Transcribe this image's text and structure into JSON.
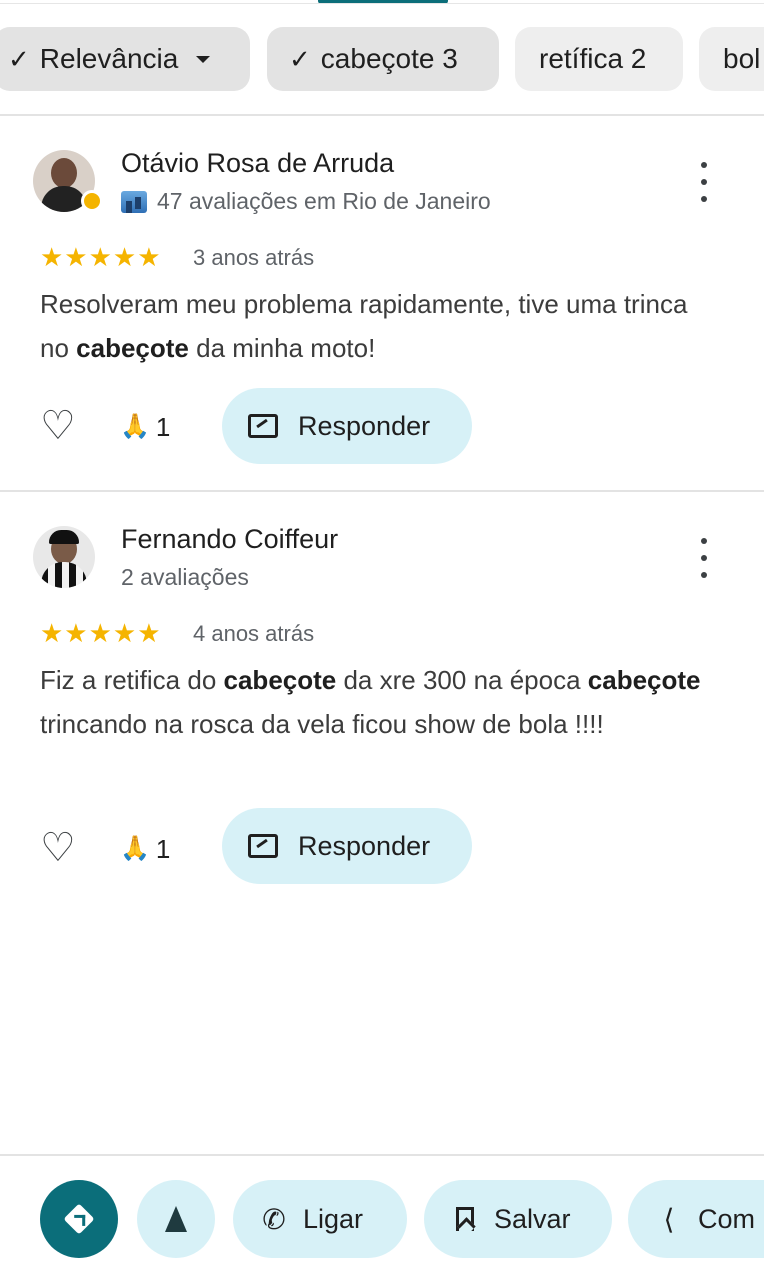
{
  "filters": {
    "sort": {
      "label": "Relevância"
    },
    "chips": [
      {
        "label": "cabeçote 3",
        "selected": true
      },
      {
        "label": "retífica 2",
        "selected": false
      },
      {
        "label": "bol",
        "selected": false
      }
    ]
  },
  "reviews": [
    {
      "author": "Otávio Rosa de Arruda",
      "meta": "47 avaliações em Rio de Janeiro",
      "local_guide": true,
      "rating": 5,
      "stars": "★★★★★",
      "time": "3 anos atrás",
      "text_parts": [
        "Resolveram meu problema rapidamente, tive uma trinca no ",
        "cabeçote",
        " da minha moto!"
      ],
      "reactions": {
        "emoji": "🙏",
        "count": "1"
      },
      "reply_label": "Responder"
    },
    {
      "author": "Fernando Coiffeur",
      "meta": "2 avaliações",
      "local_guide": false,
      "rating": 5,
      "stars": "★★★★★",
      "time": "4 anos atrás",
      "text_parts": [
        "Fiz a retifica do ",
        "cabeçote",
        " da xre 300 na época ",
        "cabeçote",
        " trincando na rosca da vela ficou show de bola !!!!"
      ],
      "reactions": {
        "emoji": "🙏",
        "count": "1"
      },
      "reply_label": "Responder"
    }
  ],
  "bottom_actions": {
    "directions": {
      "icon": "directions-icon"
    },
    "start": {
      "icon": "navigation-arrow-icon"
    },
    "call": {
      "label": "Ligar",
      "icon": "phone-icon"
    },
    "save": {
      "label": "Salvar",
      "icon": "bookmark-icon"
    },
    "share": {
      "label": "Com",
      "icon": "share-icon"
    }
  },
  "colors": {
    "accent": "#0b6e7a",
    "chip_bg": "#eeeeee",
    "action_bg": "#d7f1f7",
    "star": "#f5b400"
  }
}
